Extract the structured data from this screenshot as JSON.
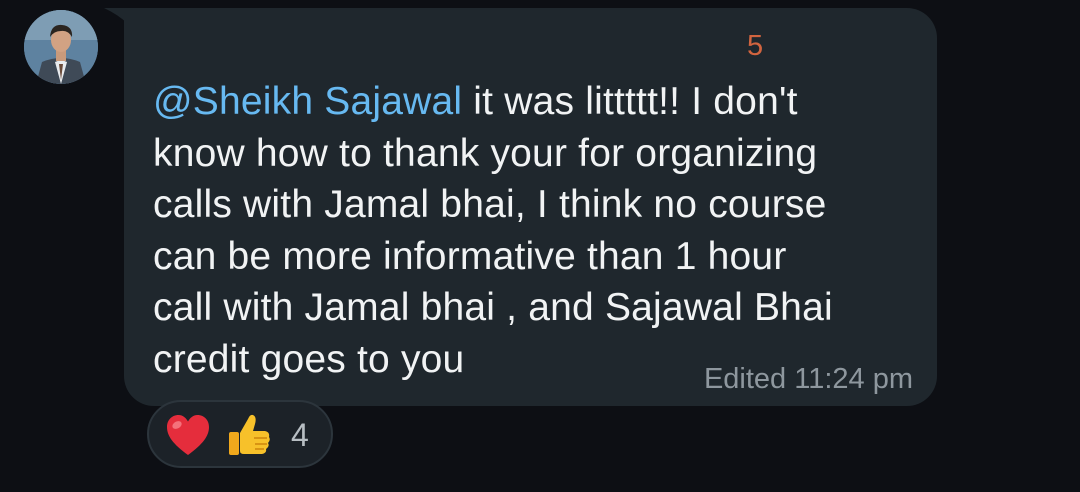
{
  "chat": {
    "sender_tag": "5",
    "message": {
      "mention": "@Sheikh Sajawal",
      "lines": [
        " it was littttt!! I don't",
        "know how to thank your for organizing",
        "calls with Jamal bhai, I think no course",
        "can be more informative than 1 hour",
        "call with Jamal bhai , and Sajawal Bhai",
        "credit goes to you"
      ]
    },
    "meta": "Edited 11:24 pm",
    "reactions": {
      "items": [
        "heart-icon",
        "thumbs-up-icon"
      ],
      "count": "4"
    },
    "colors": {
      "background": "#0d0f14",
      "bubble": "#1f272d",
      "mention": "#67b9f1",
      "sender_tag": "#d1643f",
      "meta": "#8e979e"
    }
  }
}
